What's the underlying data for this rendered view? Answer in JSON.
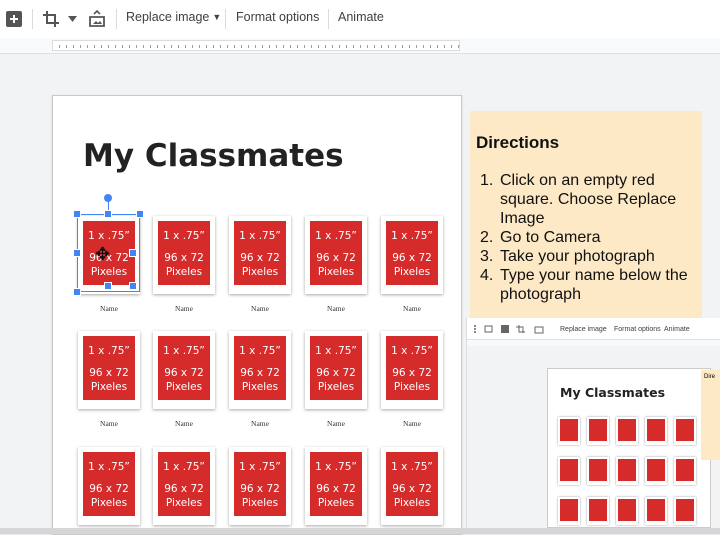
{
  "toolbar": {
    "replace_image_label": "Replace image",
    "format_options_label": "Format options",
    "animate_label": "Animate"
  },
  "slide": {
    "title": "My Classmates",
    "photo_placeholder": {
      "line1": "1 x .75”",
      "line2": "96 x 72",
      "line3": "Pixeles"
    },
    "caption": "Name",
    "rows": 3,
    "columns": 5
  },
  "directions": {
    "title": "Directions",
    "steps": [
      {
        "num": "1.",
        "text": "Click on an empty red square. Choose Replace Image"
      },
      {
        "num": "2.",
        "text": "Go to Camera"
      },
      {
        "num": "3.",
        "text": "Take your photograph"
      },
      {
        "num": "4.",
        "text": "Type your name below the photograph"
      }
    ]
  },
  "inset": {
    "toolbar": {
      "replace_image_label": "Replace image",
      "format_options_label": "Format options",
      "animate_label": "Animate"
    },
    "slide_title": "My Classmates",
    "directions_fragment": "Dire"
  },
  "colors": {
    "placeholder_red": "#d52b2b",
    "directions_bg": "#fde9c5",
    "selection_blue": "#4285f4"
  }
}
